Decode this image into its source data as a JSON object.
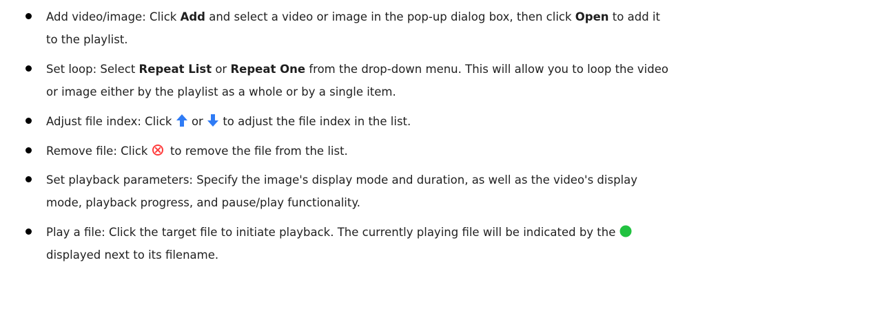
{
  "items": [
    {
      "label": "Add video/image: Click ",
      "b1": "Add",
      "t2": " and select a video or image in the pop-up dialog box, then click ",
      "b2": "Open",
      "t3": " to add it",
      "line2": "to the playlist."
    },
    {
      "label": "Set loop: Select ",
      "b1": "Repeat List",
      "t2": " or ",
      "b2": "Repeat One",
      "t3": " from the drop-down menu. This will allow you to loop the video",
      "line2": "or image either by the playlist as a whole or by a single item."
    },
    {
      "label": "Adjust file index: Click ",
      "t2": " or ",
      "t3": " to adjust the file index in the list."
    },
    {
      "label": "Remove file: Click ",
      "t2": " to remove the file from the list."
    },
    {
      "line1": "Set playback parameters: Specify the image's display mode and duration, as well as the video's display",
      "line2": "mode, playback progress, and pause/play functionality."
    },
    {
      "line1": "Play a file: Click the target file to initiate playback. The currently playing file will be indicated by the ",
      "line2": "displayed next to its filename."
    }
  ],
  "icons": {
    "up_arrow": "up-arrow-icon",
    "down_arrow": "down-arrow-icon",
    "remove": "remove-circle-x-icon",
    "playing": "playing-indicator-green-dot-icon"
  },
  "colors": {
    "arrow_blue": "#2f7bf5",
    "remove_red": "#ff3b3b",
    "playing_green": "#21c240"
  }
}
